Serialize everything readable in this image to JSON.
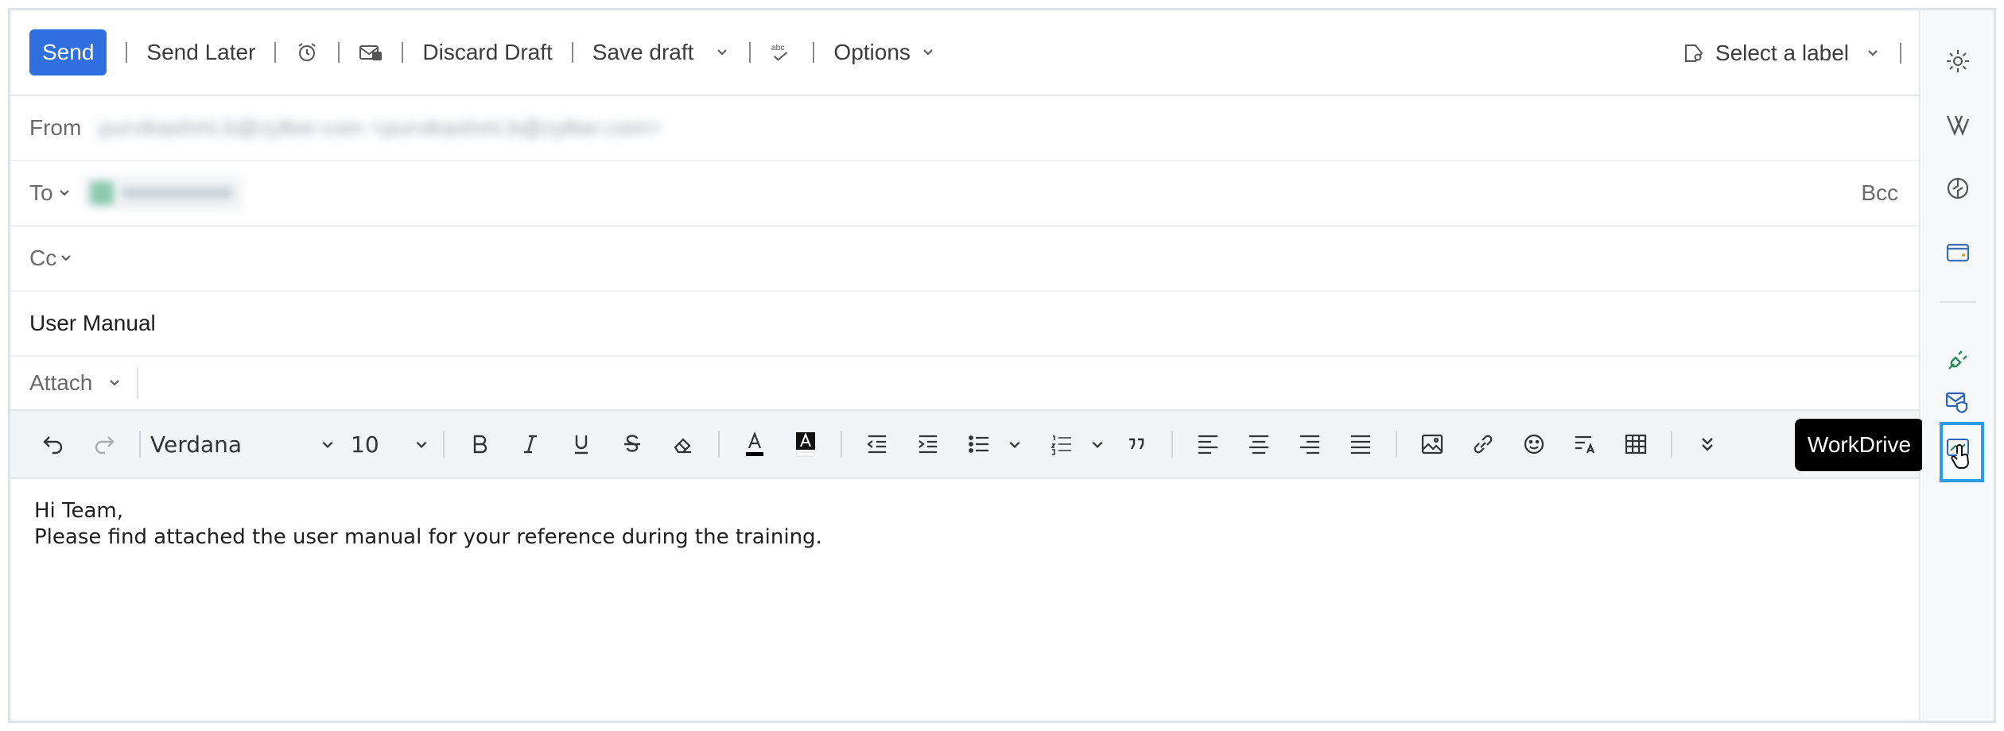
{
  "toolbar": {
    "send": "Send",
    "send_later": "Send Later",
    "discard_draft": "Discard Draft",
    "save_draft": "Save draft",
    "options": "Options",
    "select_label": "Select a label"
  },
  "fields": {
    "from_label": "From",
    "from_value": "purvikashmi.b@zylker.com <purvikashmi.b@zylker.com>",
    "to_label": "To",
    "bcc_label": "Bcc",
    "cc_label": "Cc",
    "subject": "User Manual",
    "attach_label": "Attach"
  },
  "formatting": {
    "font": "Verdana",
    "size": "10"
  },
  "body": {
    "line1": "Hi Team,",
    "line2": "Please find attached the user manual for your reference during the training."
  },
  "rail": {
    "tooltip": "WorkDrive"
  },
  "colors": {
    "accent": "#2f6fe0",
    "highlight_box": "#2b9be8",
    "rail_icon_active": "#2a8a5a"
  },
  "icons": [
    "alarm-icon",
    "envelope-lock-icon",
    "spellcheck-icon",
    "tag-icon",
    "gear-icon",
    "vertical-v-icon",
    "circle-split-icon",
    "wallet-icon",
    "plug-icon",
    "mail-shield-icon",
    "workdrive-icon"
  ]
}
